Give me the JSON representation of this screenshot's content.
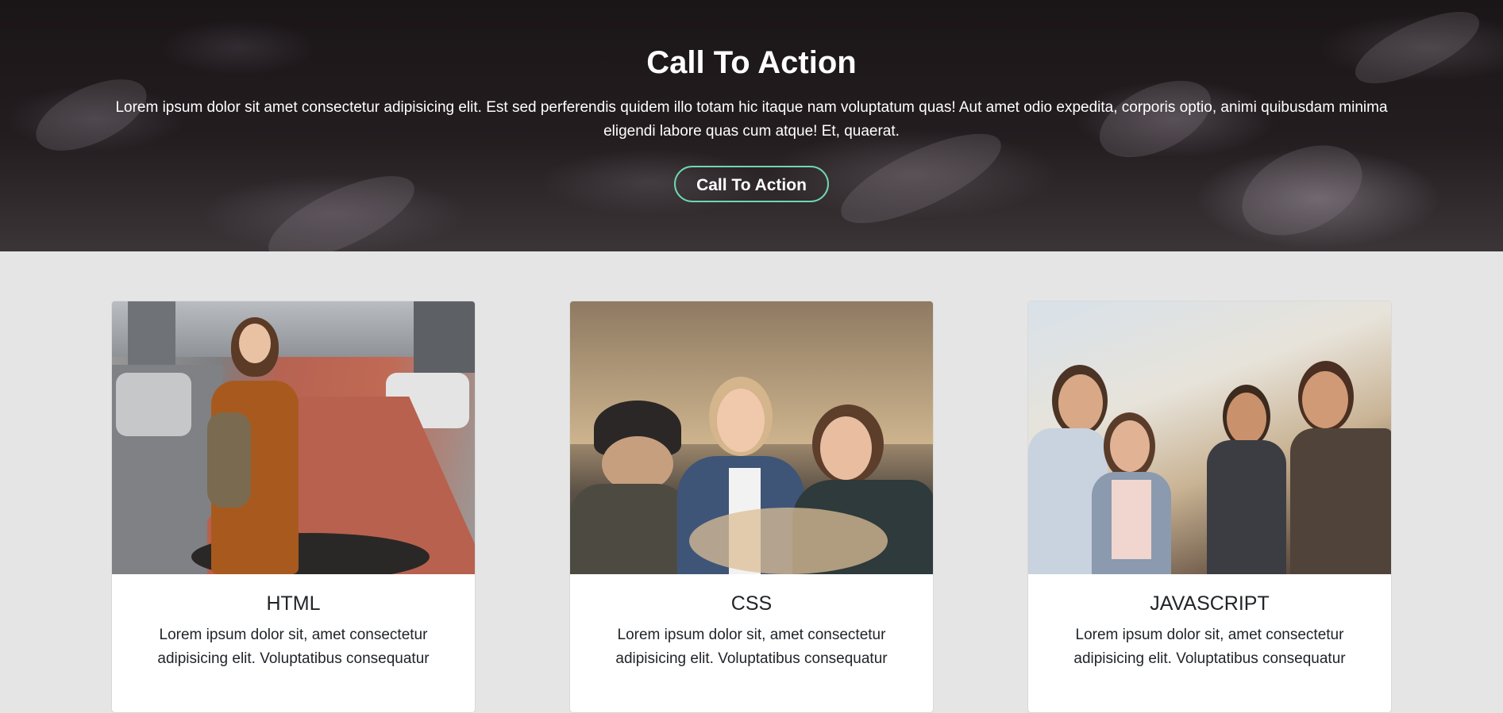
{
  "hero": {
    "title": "Call To Action",
    "text": "Lorem ipsum dolor sit amet consectetur adipisicing elit. Est sed perferendis quidem illo totam hic itaque nam voluptatum quas! Aut amet odio expedita, corporis optio, animi quibusdam minima eligendi labore quas cum atque! Et, quaerat.",
    "button_label": "Call To Action",
    "accent_color": "#6fd8ae"
  },
  "cards": [
    {
      "title": "HTML",
      "text": "Lorem ipsum dolor sit, amet consectetur adipisicing elit. Voluptatibus consequatur",
      "image": "woman-with-backpack-on-street-photo"
    },
    {
      "title": "CSS",
      "text": "Lorem ipsum dolor sit, amet consectetur adipisicing elit. Voluptatibus consequatur",
      "image": "three-women-laughing-in-field-photo"
    },
    {
      "title": "JAVASCRIPT",
      "text": "Lorem ipsum dolor sit, amet consectetur adipisicing elit. Voluptatibus consequatur",
      "image": "group-of-friends-outdoors-photo"
    }
  ]
}
